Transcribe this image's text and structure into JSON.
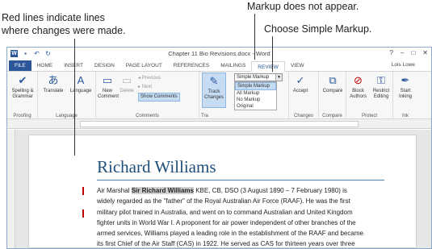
{
  "callouts": {
    "redlines_line1": "Red lines indicate lines",
    "redlines_line2": "where changes were made.",
    "no_markup": "Markup does not appear.",
    "simple_markup": "Choose Simple Markup."
  },
  "titlebar": {
    "title": "Chapter 11 Bio Revisions.docx - Word",
    "help": "?",
    "minimize": "–",
    "restore": "□",
    "close": "✕"
  },
  "tabs": [
    "FILE",
    "HOME",
    "INSERT",
    "DESIGN",
    "PAGE LAYOUT",
    "REFERENCES",
    "MAILINGS",
    "REVIEW",
    "VIEW"
  ],
  "active_tab": "REVIEW",
  "user": "Lois Lowe",
  "ribbon": {
    "proofing": {
      "label": "Proofing",
      "spelling": "Spelling &",
      "grammar": "Grammar"
    },
    "language": {
      "label": "Language",
      "translate": "Translate",
      "language": "Language"
    },
    "comments": {
      "label": "Comments",
      "new": "New",
      "comment": "Comment",
      "delete": "Delete",
      "previous": "Previous",
      "next": "Next",
      "show": "Show Comments"
    },
    "tracking": {
      "label": "Tra",
      "track": "Track",
      "changes": "Changes",
      "markup_value": "Simple Markup",
      "options": [
        "Simple Markup",
        "All Markup",
        "No Markup",
        "Original"
      ],
      "selected_option": "Simple Markup"
    },
    "changes": {
      "label": "Changes",
      "accept": "Accept"
    },
    "compare": {
      "label": "Compare",
      "compare": "Compare"
    },
    "protect": {
      "label": "Protect",
      "block": "Block",
      "authors": "Authors",
      "restrict": "Restrict",
      "editing": "Editing"
    },
    "ink": {
      "label": "Ink",
      "start": "Start",
      "inking": "Inking"
    }
  },
  "document": {
    "heading": "Richard Williams",
    "paragraph_before": "Air Marshal ",
    "highlighted": "Sir Richard Williams",
    "paragraph_after": " KBE, CB, DSO (3 August 1890 – 7 February 1980) is widely regarded as the \"father\" of the Royal Australian Air Force (RAAF). He was the first military pilot trained in Australia, and went on to command Australian and United Kingdom fighter units in World War I. A proponent for air power independent of other branches of the armed services, Williams played a leading role in the establishment of the RAAF and became its first Chief of the Air Staff (CAS) in 1922. He served as CAS for thirteen years over three terms, longer than any other officer."
  },
  "colors": {
    "accent": "#2b579a",
    "heading": "#1f4e79",
    "change_bar": "#c00000",
    "highlight": "#c5dcf3"
  }
}
